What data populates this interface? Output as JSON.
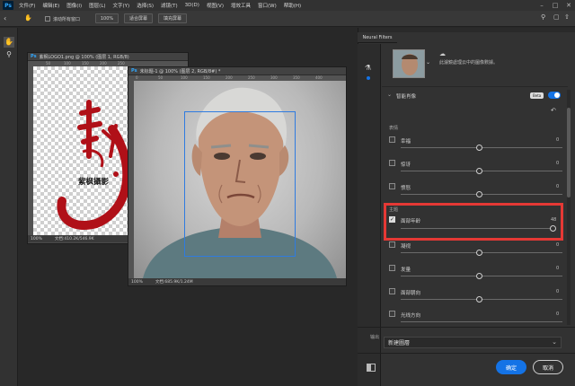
{
  "menubar": {
    "items": [
      "文件(F)",
      "编辑(E)",
      "图像(I)",
      "图层(L)",
      "文字(Y)",
      "选择(S)",
      "滤镜(T)",
      "3D(D)",
      "视图(V)",
      "增效工具",
      "窗口(W)",
      "帮助(H)"
    ],
    "app_logo": "Ps"
  },
  "options_bar": {
    "scroll_all_label": "滚动所有窗口",
    "zoom_100_label": "100%",
    "fit_screen_label": "适合屏幕",
    "fill_screen_label": "填充屏幕"
  },
  "doc_logo": {
    "title": "紫枫LOGO1.png @ 100% (图层 1, RGB/8)",
    "zoom": "100%",
    "status": "文档:410.2K/546.9K",
    "logo_text": "紫枫攝影",
    "ruler_ticks": [
      "50",
      "100",
      "150",
      "200",
      "250",
      "300",
      "350",
      "400"
    ]
  },
  "doc_main": {
    "title": "未标题-1 @ 100% (图层 2, RGB/8#) *",
    "zoom": "100%",
    "status": "文档:685.9K/1.24M",
    "ruler_ticks": [
      "0",
      "50",
      "100",
      "150",
      "200",
      "250",
      "300",
      "350",
      "400"
    ]
  },
  "panel": {
    "tab_label": "Neural Filters",
    "cloud_note": "此濾鏡處理云中的圖像數據。",
    "section_title": "智能肖像",
    "beta_label": "Beta",
    "group_mood": "表情",
    "group_theme": "主题",
    "sliders": [
      {
        "label": "幸福",
        "value": "0",
        "checked": false,
        "knob": 0.5
      },
      {
        "label": "惊讶",
        "value": "0",
        "checked": false,
        "knob": 0.5
      },
      {
        "label": "愤怒",
        "value": "0",
        "checked": false,
        "knob": 0.5
      },
      {
        "label": "面部年龄",
        "value": "48",
        "checked": true,
        "knob": 0.92
      },
      {
        "label": "凝视",
        "value": "0",
        "checked": false,
        "knob": 0.5
      },
      {
        "label": "发量",
        "value": "0",
        "checked": false,
        "knob": 0.5
      },
      {
        "label": "面部朝向",
        "value": "0",
        "checked": false,
        "knob": 0.5
      },
      {
        "label": "光线方向",
        "value": "0",
        "checked": false,
        "knob": 0.5
      }
    ],
    "output_label": "输出",
    "output_value": "新建圖層",
    "ok_label": "确定",
    "cancel_label": "取消"
  },
  "colors": {
    "accent": "#1473e6",
    "highlight_box": "#e53935",
    "face_box": "#2f7be0",
    "logo_red": "#b01018"
  }
}
